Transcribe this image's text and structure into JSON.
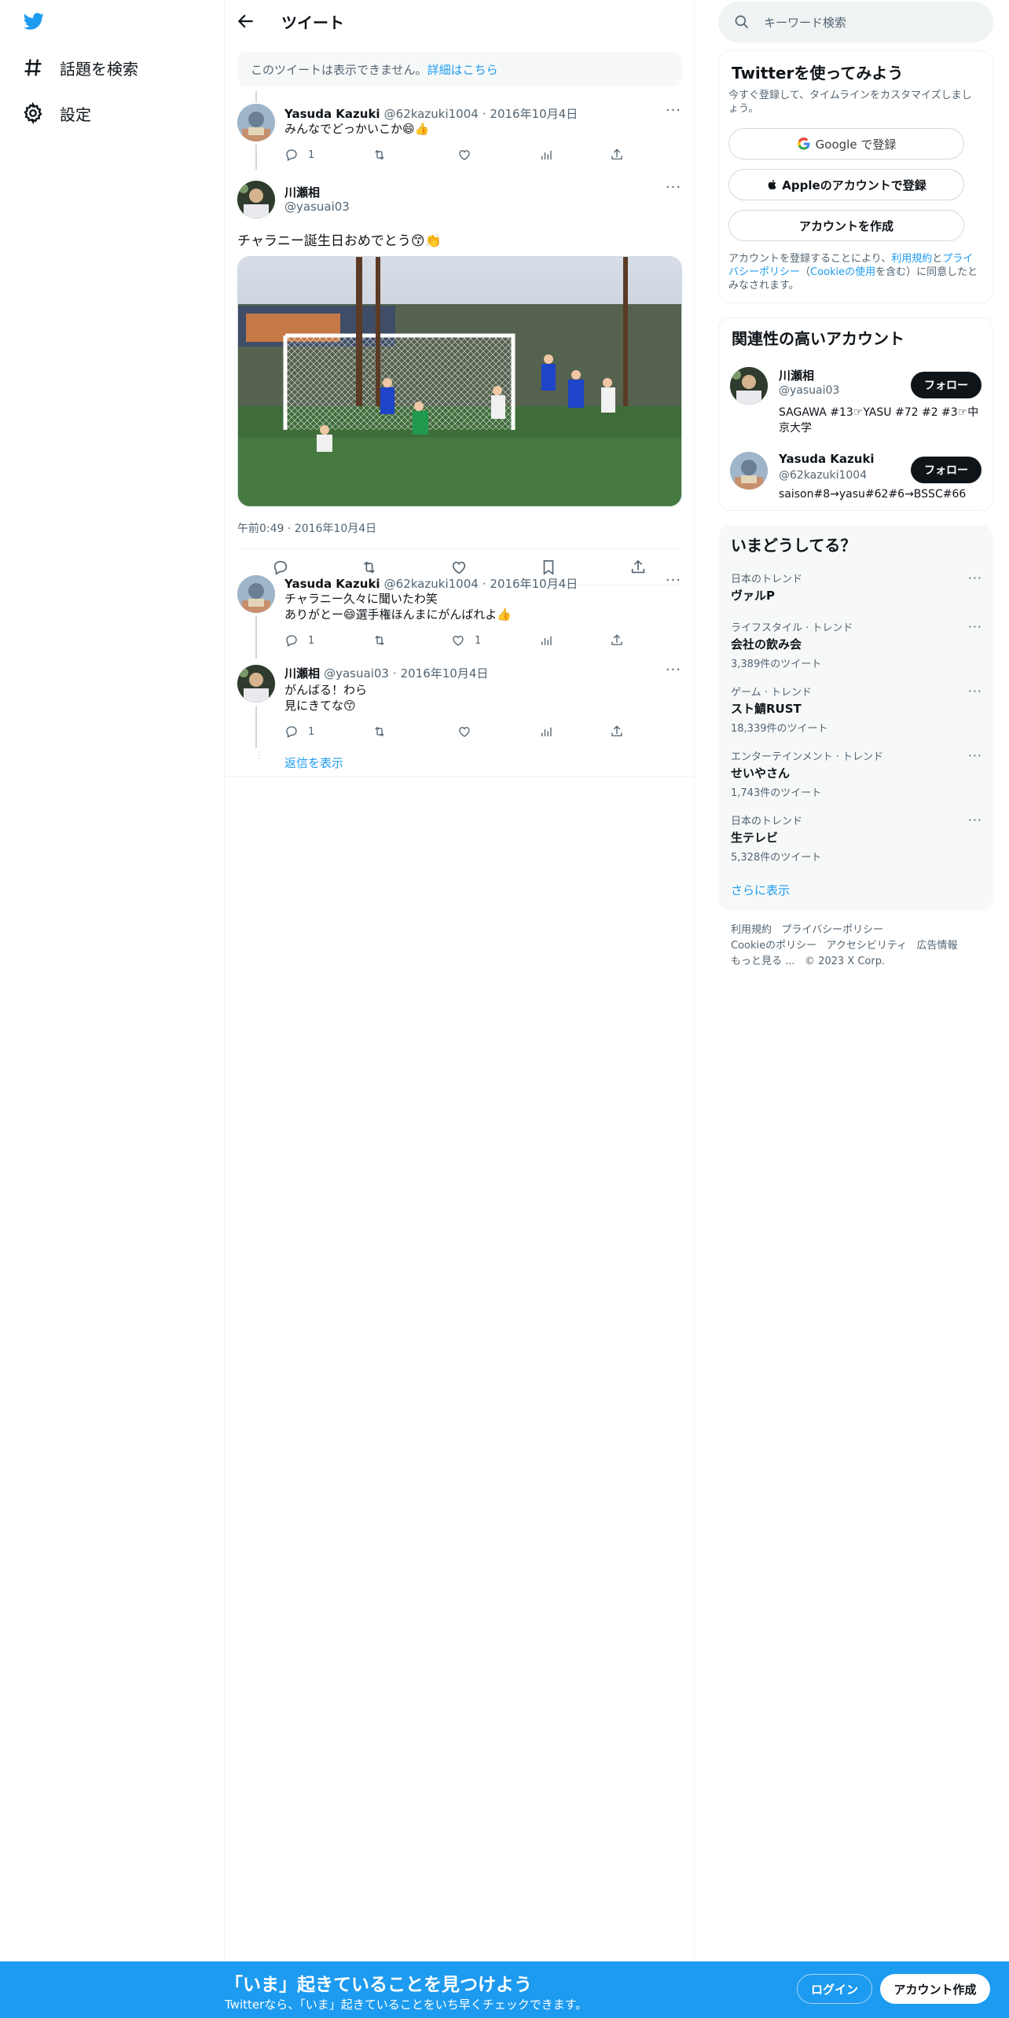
{
  "nav": {
    "explore_label": "話題を検索",
    "settings_label": "設定"
  },
  "header": {
    "title": "ツイート"
  },
  "notice": {
    "text": "このツイートは表示できません。",
    "link": "詳細はこちら"
  },
  "tweets": [
    {
      "name": "Yasuda Kazuki",
      "handle": "@62kazuki1004",
      "date": "· 2016年10月4日",
      "text": "みんなでどっかいこか😄👍",
      "replies": "1",
      "retweets": "",
      "likes": ""
    },
    {
      "name": "Yasuda Kazuki",
      "handle": "@62kazuki1004",
      "date": "· 2016年10月4日",
      "text_line1": "チャラニー久々に聞いたわ笑",
      "text_line2": "ありがとー😄選手権ほんまにがんばれよ👍",
      "replies": "1",
      "retweets": "",
      "likes": "1"
    },
    {
      "name": "川瀬相",
      "handle": "@yasuai03",
      "date": "· 2016年10月4日",
      "text_line1": "がんばる！わら",
      "text_line2": "見にきてな😙",
      "replies": "1",
      "retweets": "",
      "likes": ""
    }
  ],
  "main_tweet": {
    "name": "川瀬相",
    "handle": "@yasuai03",
    "text": "チャラニー誕生日おめでとう😙👏",
    "timestamp": "午前0:49 · 2016年10月4日"
  },
  "show_replies": "返信を表示",
  "search": {
    "placeholder": "キーワード検索"
  },
  "signup_card": {
    "title": "Twitterを使ってみよう",
    "subtitle": "今すぐ登録して、タイムラインをカスタマイズしましょう。",
    "google": "Google で登録",
    "apple": "Appleのアカウントで登録",
    "create": "アカウントを作成",
    "legal_prefix": "アカウントを登録することにより、",
    "terms": "利用規約",
    "and": "と",
    "privacy": "プライバシーポリシー",
    "paren_open": "（",
    "cookie": "Cookieの使用",
    "legal_suffix": "を含む）に同意したとみなされます。"
  },
  "related": {
    "title": "関連性の高いアカウント",
    "accounts": [
      {
        "name": "川瀬相",
        "handle": "@yasuai03",
        "bio": "SAGAWA #13☞YASU #72 #2 #3☞中京大学",
        "follow": "フォロー"
      },
      {
        "name": "Yasuda Kazuki",
        "handle": "@62kazuki1004",
        "bio": "saison#8→yasu#62#6→BSSC#66",
        "follow": "フォロー"
      }
    ]
  },
  "trends": {
    "title": "いまどうしてる？",
    "items": [
      {
        "category": "日本のトレンド",
        "name": "ヴァルP",
        "count": ""
      },
      {
        "category": "ライフスタイル · トレンド",
        "name": "会社の飲み会",
        "count": "3,389件のツイート"
      },
      {
        "category": "ゲーム · トレンド",
        "name": "スト鯖RUST",
        "count": "18,339件のツイート"
      },
      {
        "category": "エンターテインメント · トレンド",
        "name": "せいやさん",
        "count": "1,743件のツイート"
      },
      {
        "category": "日本のトレンド",
        "name": "生テレビ",
        "count": "5,328件のツイート"
      }
    ],
    "show_more": "さらに表示"
  },
  "footer": {
    "terms": "利用規約",
    "privacy": "プライバシーポリシー",
    "cookie": "Cookieのポリシー",
    "accessibility": "アクセシビリティ",
    "ads": "広告情報",
    "more": "もっと見る ...",
    "copyright": "© 2023 X Corp."
  },
  "bottom_bar": {
    "title": "「いま」起きていることを見つけよう",
    "subtitle": "Twitterなら、「いま」起きていることをいち早くチェックできます。",
    "login": "ログイン",
    "signup": "アカウント作成"
  },
  "colors": {
    "accent": "#1d9bf0",
    "text": "#0f1419",
    "muted": "#536471"
  }
}
